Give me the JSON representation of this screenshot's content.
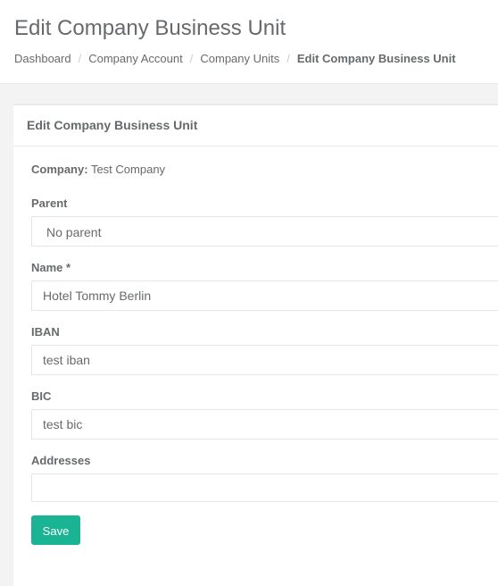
{
  "header": {
    "title": "Edit Company Business Unit",
    "breadcrumb": [
      "Dashboard",
      "Company Account",
      "Company Units",
      "Edit Company Business Unit"
    ],
    "separator": "/"
  },
  "panel": {
    "title": "Edit Company Business Unit",
    "company_label": "Company:",
    "company_value": "Test Company",
    "fields": {
      "parent": {
        "label": "Parent",
        "value": "No parent"
      },
      "name": {
        "label": "Name *",
        "value": "Hotel Tommy Berlin"
      },
      "iban": {
        "label": "IBAN",
        "value": "test iban"
      },
      "bic": {
        "label": "BIC",
        "value": "test bic"
      },
      "addresses": {
        "label": "Addresses",
        "value": ""
      }
    },
    "save_label": "Save"
  },
  "colors": {
    "primary": "#1ab394",
    "text": "#676a6c",
    "background": "#f3f3f4"
  }
}
